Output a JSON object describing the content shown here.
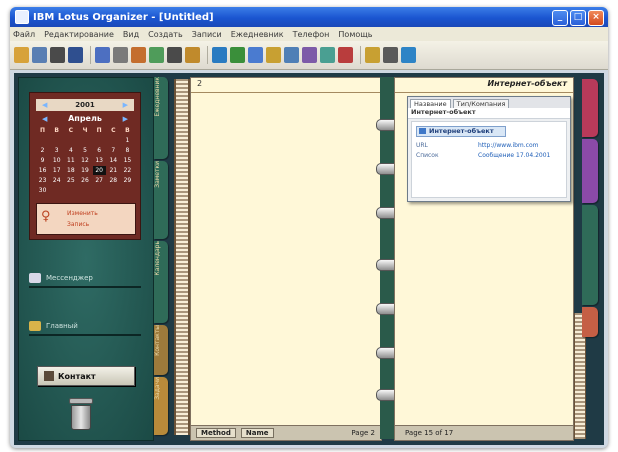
{
  "window": {
    "title": "IBM Lotus Organizer - [Untitled]",
    "buttons": {
      "minimize": "_",
      "maximize": "□",
      "close": "×"
    }
  },
  "menu": {
    "items": [
      "Файл",
      "Редактирование",
      "Вид",
      "Создать",
      "Записи",
      "Ежедневник",
      "Телефон",
      "Помощь"
    ]
  },
  "toolbar": {
    "buttons": [
      {
        "name": "open-icon",
        "color": "#d7a23a"
      },
      {
        "name": "new-icon",
        "color": "#5a7fb3"
      },
      {
        "name": "print-icon",
        "color": "#4a4a4a"
      },
      {
        "name": "save-icon",
        "color": "#2f4f8f"
      },
      {
        "name": "link-icon",
        "color": "#4d6fc1"
      },
      {
        "name": "cut-icon",
        "color": "#7a7a7a"
      },
      {
        "name": "copy-icon",
        "color": "#c46e2e"
      },
      {
        "name": "paste-icon",
        "color": "#4f9c5a"
      },
      {
        "name": "undo-icon",
        "color": "#4a4a4a"
      },
      {
        "name": "redo-icon",
        "color": "#c08a2c"
      },
      {
        "name": "find-icon",
        "color": "#2a7bc1"
      },
      {
        "name": "notes-icon",
        "color": "#3a8f3a"
      },
      {
        "name": "calendar-icon",
        "color": "#4a7bd0"
      },
      {
        "name": "todo-icon",
        "color": "#c8a032"
      },
      {
        "name": "address-icon",
        "color": "#4f7fb6"
      },
      {
        "name": "calls-icon",
        "color": "#7d5aa8"
      },
      {
        "name": "planner-icon",
        "color": "#4a9f92"
      },
      {
        "name": "anniversary-icon",
        "color": "#b93d3d"
      },
      {
        "name": "tools-icon",
        "color": "#c8a032"
      },
      {
        "name": "alarm-icon",
        "color": "#5a5a5a"
      },
      {
        "name": "help-icon",
        "color": "#2e84c6"
      }
    ]
  },
  "left_panel": {
    "calendar": {
      "year": "2001",
      "month": "Апрель",
      "weekdays": [
        "П",
        "В",
        "С",
        "Ч",
        "П",
        "С",
        "В"
      ],
      "days": [
        "",
        "",
        "",
        "",
        "",
        "",
        "1",
        "2",
        "3",
        "4",
        "5",
        "6",
        "7",
        "8",
        "9",
        "10",
        "11",
        "12",
        "13",
        "14",
        "15",
        "16",
        "17",
        "18",
        "19",
        "20",
        "21",
        "22",
        "23",
        "24",
        "25",
        "26",
        "27",
        "28",
        "29",
        "30",
        "",
        "",
        "",
        "",
        "",
        ""
      ],
      "today": "20",
      "notes": [
        "Изменить",
        "Запись"
      ]
    },
    "links": [
      {
        "label": "Мессенджер"
      },
      {
        "label": "Главный"
      }
    ],
    "contacts_button": "Контакт",
    "side_tabs": [
      {
        "label": "Ежедневник",
        "color": "#2f6b58"
      },
      {
        "label": "Заметки",
        "color": "#2f6b58"
      },
      {
        "label": "Календарь",
        "color": "#2f6b58"
      },
      {
        "label": "Контакты",
        "color": "#9d7a3b"
      },
      {
        "label": "Задачи",
        "color": "#b88a3a"
      }
    ]
  },
  "left_page": {
    "page_number": "2",
    "footer_buttons": [
      "Method",
      "Name"
    ],
    "footer_text": "Page 2"
  },
  "right_page": {
    "title": "Интернет-объект",
    "popup": {
      "tabs": [
        "Название",
        "Тип/Компания"
      ],
      "header": "Интернет-объект",
      "item": "Интернет-объект",
      "lines": [
        {
          "label": "URL",
          "value": "http://www.ibm.com"
        },
        {
          "label": "Список",
          "value": "Сообщение 17.04.2001"
        }
      ]
    },
    "footer_text": "Page 15 of 17"
  },
  "right_tabs": [
    {
      "color": "#b83a5a"
    },
    {
      "color": "#8b4aa8"
    },
    {
      "color": "#2f6b58"
    },
    {
      "color": "#c55f45"
    }
  ]
}
